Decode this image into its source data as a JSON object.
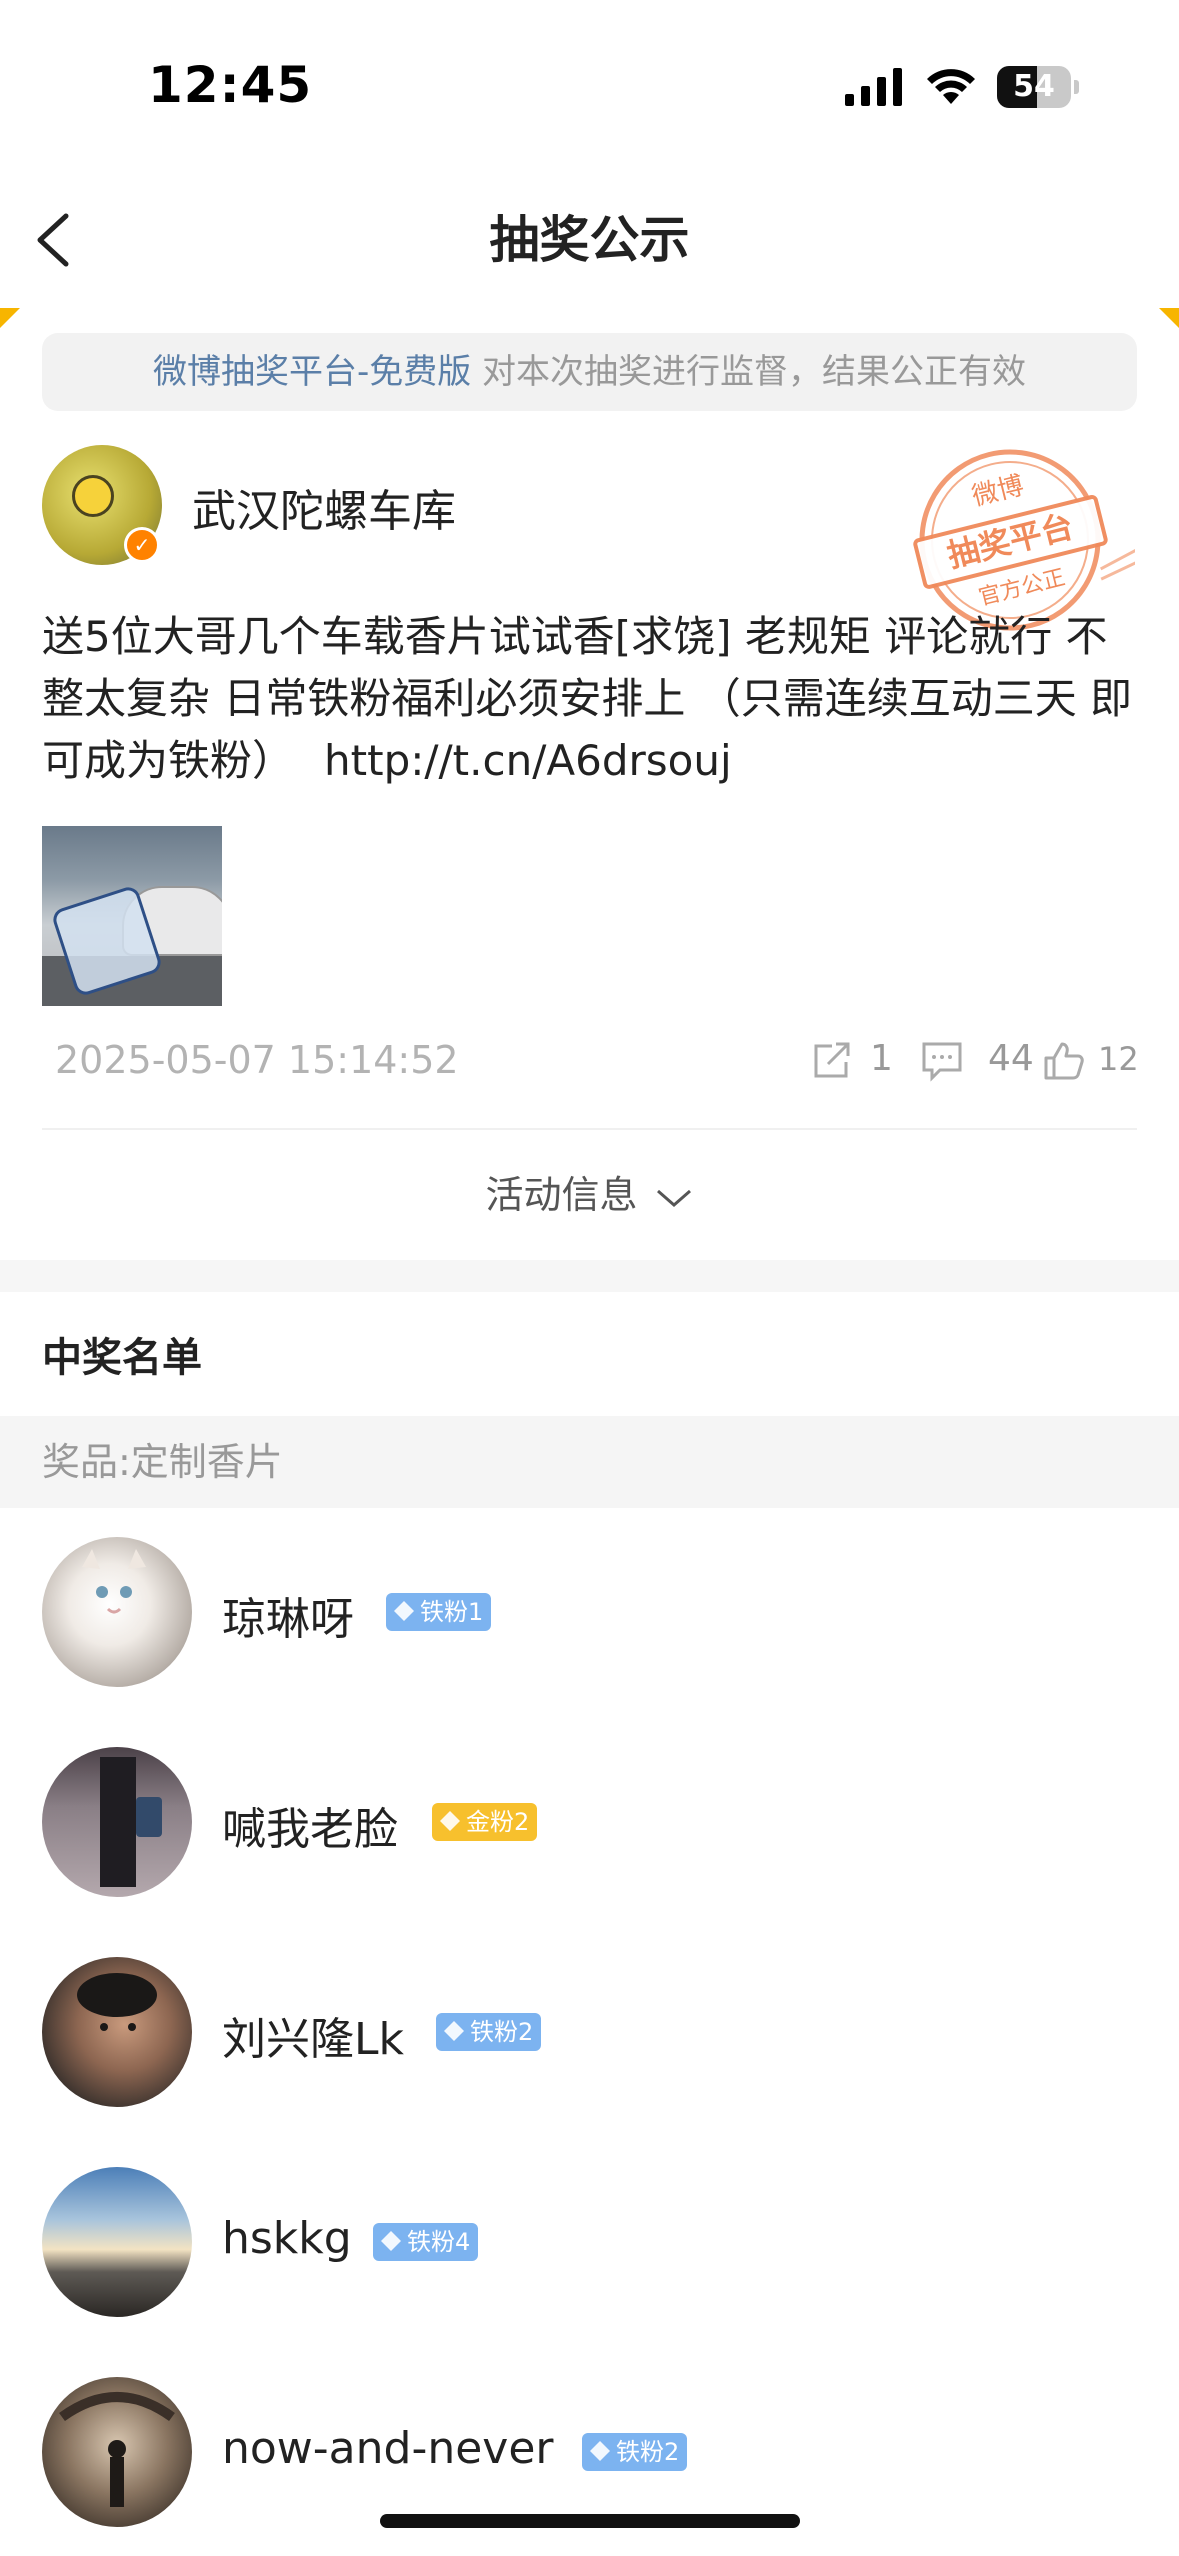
{
  "status_bar": {
    "time": "12:45",
    "battery": "54",
    "battery_level": 0.54,
    "icons": [
      "signal-icon",
      "wifi-icon",
      "battery-icon"
    ]
  },
  "nav": {
    "title": "抽奖公示",
    "back_icon": "chevron-left-icon"
  },
  "notice": {
    "platform": "微博抽奖平台-免费版",
    "text": " 对本次抽奖进行监督，结果公正有效"
  },
  "author": {
    "name": "武汉陀螺车库",
    "verified": true
  },
  "stamp": {
    "top": "微博",
    "middle": "抽奖平台",
    "bottom": "官方公正"
  },
  "post": {
    "text": "送5位大哥几个车载香片试试香[求饶] 老规矩 评论就行 不整太复杂 日常铁粉福利必须安排上 （只需连续互动三天 即可成为铁粉）",
    "link": "http://t.cn/A6drsouj",
    "time": "2025-05-07 15:14:52",
    "shares": "1",
    "comments": "44",
    "likes": "12"
  },
  "activity": {
    "label": "活动信息"
  },
  "winners": {
    "title": "中奖名单",
    "prize": "奖品:定制香片",
    "list": [
      {
        "name": "琼琳呀",
        "badge": "铁粉1",
        "badge_type": "iron"
      },
      {
        "name": "喊我老脸",
        "badge": "金粉2",
        "badge_type": "gold"
      },
      {
        "name": "刘兴隆Lk",
        "badge": "铁粉2",
        "badge_type": "iron"
      },
      {
        "name": "hskkg",
        "badge": "铁粉4",
        "badge_type": "iron"
      },
      {
        "name": "now-and-never",
        "badge": "铁粉2",
        "badge_type": "iron"
      }
    ]
  },
  "colors": {
    "accent": "#f7b500",
    "link": "#5b7fa8",
    "iron_badge": "#7cb3f0",
    "gold_badge": "#f7c02d",
    "verified": "#ff8200",
    "stamp": "#f08a5a"
  }
}
